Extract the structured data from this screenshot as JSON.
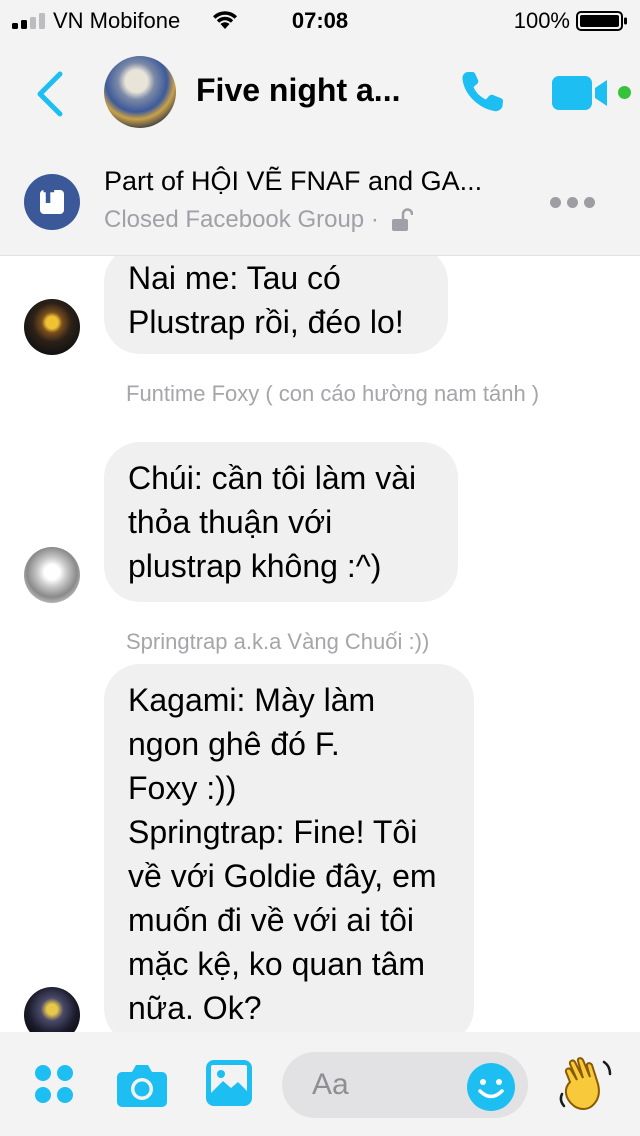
{
  "status_bar": {
    "carrier": "VN Mobifone",
    "time": "07:08",
    "battery": "100%"
  },
  "header": {
    "title": "Five night a...",
    "accent_color": "#1dbef2"
  },
  "group": {
    "title": "Part of HỘI VẼ FNAF and GA...",
    "subtitle": "Closed Facebook Group ·"
  },
  "messages": [
    {
      "sender": "",
      "lines": [
        "Nai me: Tau có",
        "Plustrap rồi, đéo lo!"
      ]
    },
    {
      "sender": "Funtime Foxy ( con cáo hường nam tánh )",
      "lines": [
        "Chúi: cần tôi làm vài",
        "thỏa thuận với",
        "plustrap không :^)"
      ]
    },
    {
      "sender": "Springtrap a.k.a Vàng Chuối :))",
      "lines": [
        "Kagami: Mày làm",
        "ngon ghê đó F.",
        "Foxy :))",
        "Springtrap: Fine! Tôi",
        "về với Goldie đây, em",
        "muốn đi về với ai tôi",
        "mặc kệ, ko quan tâm",
        "nữa. Ok?"
      ]
    }
  ],
  "composer": {
    "placeholder": "Aa"
  }
}
